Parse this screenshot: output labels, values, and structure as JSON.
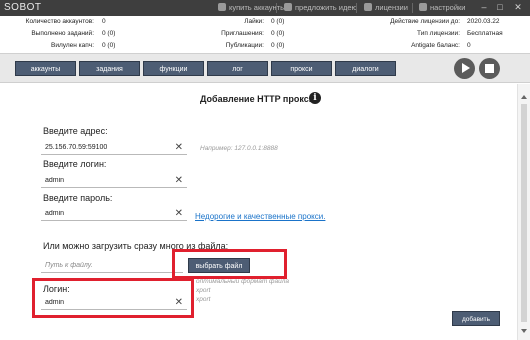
{
  "window": {
    "title": "SOBOT",
    "links": [
      {
        "label": "купить аккаунты",
        "icon": "user-icon"
      },
      {
        "label": "предложить идею",
        "icon": "lightbulb-icon"
      },
      {
        "label": "лицензии",
        "icon": "license-icon"
      },
      {
        "label": "настройки",
        "icon": "gear-icon"
      }
    ],
    "controls": {
      "minimize": "–",
      "maximize": "□",
      "close": "✕"
    }
  },
  "stats": {
    "accounts_label": "Количество аккаунтов:",
    "accounts_value": "0",
    "tasks_done_label": "Выполнено заданий:",
    "tasks_done_value": "0 (0)",
    "out_of_capacity_label": "Вилулен капч:",
    "out_of_capacity_value": "0 (0)",
    "likes_label": "Лайки:",
    "likes_value": "0 (0)",
    "invites_label": "Приглашения:",
    "invites_value": "0 (0)",
    "posts_label": "Публикации:",
    "posts_value": "0 (0)",
    "license_until_label": "Действие лицензии до:",
    "license_until_value": "2020.03.22",
    "license_type_label": "Тип лицензии:",
    "license_type_value": "Бесплатная",
    "antigate_label": "Antigate баланс:",
    "antigate_value": "0"
  },
  "toolbar": {
    "tabs": [
      "аккаунты",
      "задания",
      "функции",
      "лог",
      "прокси",
      "диалоги"
    ]
  },
  "form": {
    "heading": "Добавление HTTP прокси",
    "address_label": "Введите адрес:",
    "address_value": "25.156.70.59:59100",
    "address_hint": "Например: 127.0.0.1:8888",
    "login_label": "Введите логин:",
    "login_value": "admin",
    "password_label": "Введите пароль:",
    "password_value": "admin",
    "proxy_link": "Недорогие и качественные прокси.",
    "file_label": "Или можно загрузить сразу много из файла:",
    "file_placeholder": "Путь к файлу.",
    "file_button": "выбрать файл",
    "file_hint_1": "оптимальный формат файла",
    "file_hint_2": "xport",
    "file_hint_3": "xport",
    "login2_label": "Логин:",
    "login2_value": "admin",
    "add_button": "добавить"
  },
  "highlight_color": "#e0202e"
}
